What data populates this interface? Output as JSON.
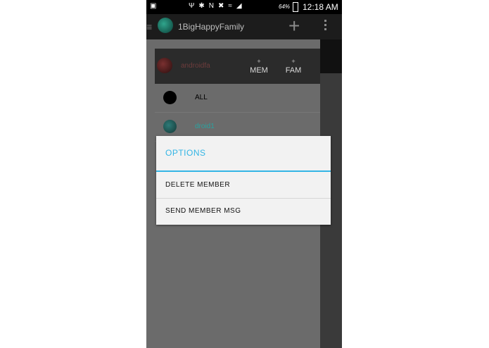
{
  "statusbar": {
    "battery_pct": "64%",
    "time": "12:18 AM"
  },
  "appbar": {
    "title": "1BigHappyFamily",
    "add_icon": "plus-icon",
    "menu_icon": "overflow-menu-icon"
  },
  "family_header": {
    "name": "androidfa",
    "add_member_plus": "+",
    "add_member_label": "MEM",
    "add_family_plus": "+",
    "add_family_label": "FAM"
  },
  "members": [
    {
      "label": "ALL",
      "avatar_color": "#000000",
      "label_color": "#000000"
    },
    {
      "label": "droid1",
      "avatar_color": "#1f5c5a",
      "label_color": "#2aa3a0"
    }
  ],
  "dialog": {
    "title": "OPTIONS",
    "accent_color": "#33b5e5",
    "items": [
      {
        "label": "DELETE MEMBER"
      },
      {
        "label": "SEND MEMBER MSG"
      }
    ]
  }
}
